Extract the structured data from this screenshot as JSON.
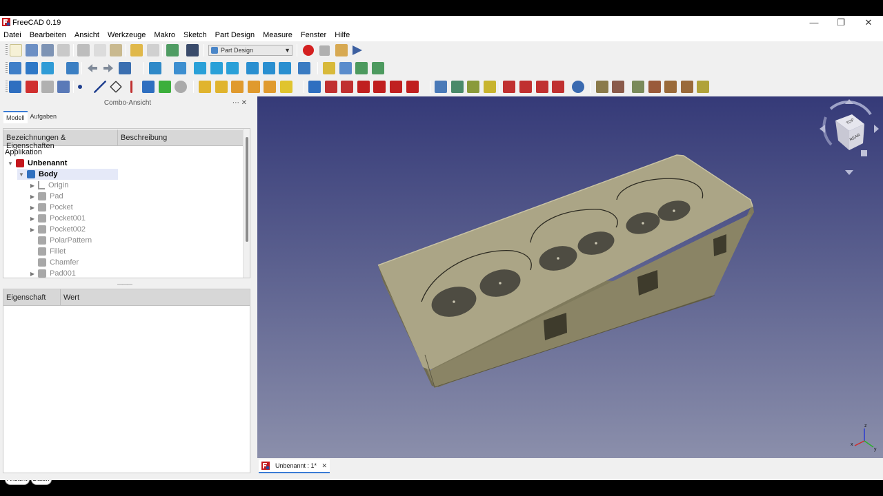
{
  "window": {
    "title": "FreeCAD 0.19"
  },
  "menu": [
    "Datei",
    "Bearbeiten",
    "Ansicht",
    "Werkzeuge",
    "Makro",
    "Sketch",
    "Part Design",
    "Measure",
    "Fenster",
    "Hilfe"
  ],
  "toolbar": {
    "workbench": "Part Design"
  },
  "combo": {
    "title": "Combo-Ansicht",
    "tabs": [
      "Modell",
      "Aufgaben"
    ],
    "tree_headers": [
      "Bezeichnungen & Eigenschaften",
      "Beschreibung"
    ],
    "section": "Applikation",
    "document": "Unbenannt",
    "body": "Body",
    "features": [
      "Origin",
      "Pad",
      "Pocket",
      "Pocket001",
      "Pocket002",
      "PolarPattern",
      "Fillet",
      "Chamfer",
      "Pad001"
    ],
    "prop_headers": [
      "Eigenschaft",
      "Wert"
    ],
    "bottom_tabs": [
      "Ansicht",
      "Daten"
    ]
  },
  "document_tab": {
    "label": "Unbenannt : 1*"
  },
  "navcube": {
    "face_top": "TOP",
    "face_front": "REAR"
  },
  "axes": {
    "x": "x",
    "y": "y",
    "z": "z"
  },
  "colors": {
    "model": "#a8a183",
    "viewport_top": "#353a78",
    "viewport_bottom": "#8b8fab"
  }
}
